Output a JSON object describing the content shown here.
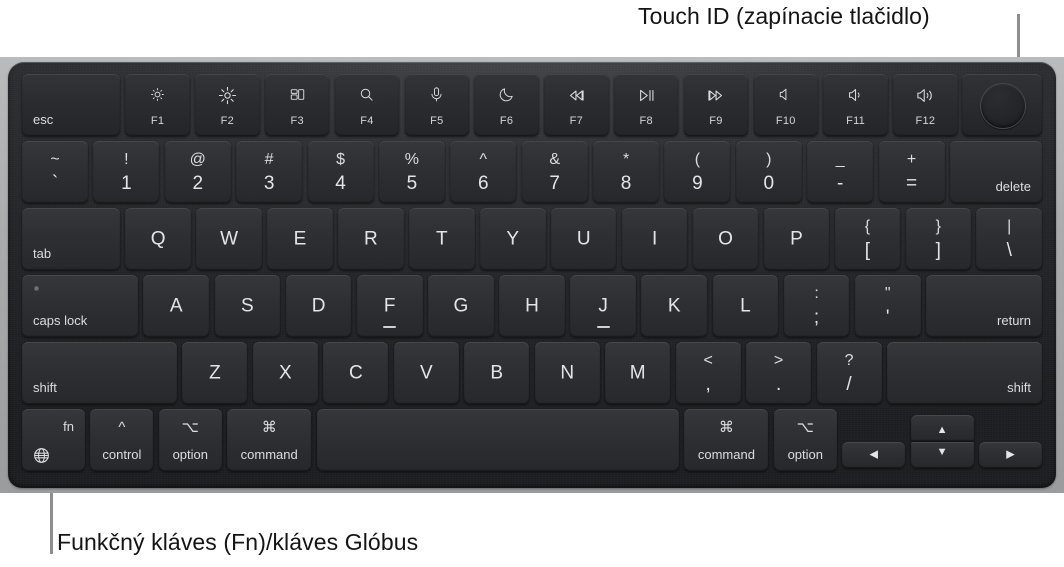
{
  "callouts": {
    "top": "Touch ID (zapínacie tlačidlo)",
    "bottom": "Funkčný kláves (Fn)/kláves Glóbus"
  },
  "colors": {
    "page_background": "#ffffff",
    "chassis_outer": "#aaacae",
    "deck_dark": "#26282b",
    "key_face": "#2d2f32",
    "key_text": "#e2e3e5",
    "leader_line": "#8e8e8e",
    "callout_text": "#141414"
  },
  "keyboard": {
    "layout_name": "MacBook US keyboard with Touch ID",
    "rows": {
      "function_row": [
        {
          "id": "esc",
          "main": "esc",
          "style": "word-bl"
        },
        {
          "id": "f1",
          "icon": "brightness-down-icon",
          "fnum": "F1",
          "style": "icon-fn"
        },
        {
          "id": "f2",
          "icon": "brightness-up-icon",
          "fnum": "F2",
          "style": "icon-fn"
        },
        {
          "id": "f3",
          "icon": "mission-control-icon",
          "fnum": "F3",
          "style": "icon-fn"
        },
        {
          "id": "f4",
          "icon": "spotlight-search-icon",
          "fnum": "F4",
          "style": "icon-fn"
        },
        {
          "id": "f5",
          "icon": "dictation-mic-icon",
          "fnum": "F5",
          "style": "icon-fn"
        },
        {
          "id": "f6",
          "icon": "do-not-disturb-moon-icon",
          "fnum": "F6",
          "style": "icon-fn"
        },
        {
          "id": "f7",
          "icon": "rewind-icon",
          "fnum": "F7",
          "style": "icon-fn"
        },
        {
          "id": "f8",
          "icon": "play-pause-icon",
          "fnum": "F8",
          "style": "icon-fn"
        },
        {
          "id": "f9",
          "icon": "fast-forward-icon",
          "fnum": "F9",
          "style": "icon-fn"
        },
        {
          "id": "f10",
          "icon": "volume-mute-icon",
          "fnum": "F10",
          "style": "icon-fn"
        },
        {
          "id": "f11",
          "icon": "volume-down-icon",
          "fnum": "F11",
          "style": "icon-fn"
        },
        {
          "id": "f12",
          "icon": "volume-up-icon",
          "fnum": "F12",
          "style": "icon-fn"
        },
        {
          "id": "touch-id",
          "icon": "touch-id-icon",
          "style": "touch-id"
        }
      ],
      "number_row": [
        {
          "id": "grave",
          "upper": "~",
          "lower": "`"
        },
        {
          "id": "1",
          "upper": "!",
          "lower": "1"
        },
        {
          "id": "2",
          "upper": "@",
          "lower": "2"
        },
        {
          "id": "3",
          "upper": "#",
          "lower": "3"
        },
        {
          "id": "4",
          "upper": "$",
          "lower": "4"
        },
        {
          "id": "5",
          "upper": "%",
          "lower": "5"
        },
        {
          "id": "6",
          "upper": "^",
          "lower": "6"
        },
        {
          "id": "7",
          "upper": "&",
          "lower": "7"
        },
        {
          "id": "8",
          "upper": "*",
          "lower": "8"
        },
        {
          "id": "9",
          "upper": "(",
          "lower": "9"
        },
        {
          "id": "0",
          "upper": ")",
          "lower": "0"
        },
        {
          "id": "minus",
          "upper": "_",
          "lower": "-"
        },
        {
          "id": "equal",
          "upper": "+",
          "lower": "="
        },
        {
          "id": "delete",
          "main": "delete",
          "style": "word-br"
        }
      ],
      "tab_row": [
        {
          "id": "tab",
          "main": "tab",
          "style": "word-bl"
        },
        {
          "id": "q",
          "main": "Q"
        },
        {
          "id": "w",
          "main": "W"
        },
        {
          "id": "e",
          "main": "E"
        },
        {
          "id": "r",
          "main": "R"
        },
        {
          "id": "t",
          "main": "T"
        },
        {
          "id": "y",
          "main": "Y"
        },
        {
          "id": "u",
          "main": "U"
        },
        {
          "id": "i",
          "main": "I"
        },
        {
          "id": "o",
          "main": "O"
        },
        {
          "id": "p",
          "main": "P"
        },
        {
          "id": "bracket-left",
          "upper": "{",
          "lower": "["
        },
        {
          "id": "bracket-right",
          "upper": "}",
          "lower": "]"
        },
        {
          "id": "backslash",
          "upper": "|",
          "lower": "\\"
        }
      ],
      "home_row": [
        {
          "id": "caps-lock",
          "main": "caps lock",
          "style": "word-bl",
          "indicator": true
        },
        {
          "id": "a",
          "main": "A"
        },
        {
          "id": "s",
          "main": "S"
        },
        {
          "id": "d",
          "main": "D"
        },
        {
          "id": "f",
          "main": "F",
          "homing": true
        },
        {
          "id": "g",
          "main": "G"
        },
        {
          "id": "h",
          "main": "H"
        },
        {
          "id": "j",
          "main": "J",
          "homing": true
        },
        {
          "id": "k",
          "main": "K"
        },
        {
          "id": "l",
          "main": "L"
        },
        {
          "id": "semicolon",
          "upper": ":",
          "lower": ";"
        },
        {
          "id": "quote",
          "upper": "\"",
          "lower": "'"
        },
        {
          "id": "return",
          "main": "return",
          "style": "word-br"
        }
      ],
      "shift_row": [
        {
          "id": "shift-left",
          "main": "shift",
          "style": "word-bl"
        },
        {
          "id": "z",
          "main": "Z"
        },
        {
          "id": "x",
          "main": "X"
        },
        {
          "id": "c",
          "main": "C"
        },
        {
          "id": "v",
          "main": "V"
        },
        {
          "id": "b",
          "main": "B"
        },
        {
          "id": "n",
          "main": "N"
        },
        {
          "id": "m",
          "main": "M"
        },
        {
          "id": "comma",
          "upper": "<",
          "lower": ","
        },
        {
          "id": "period",
          "upper": ">",
          "lower": "."
        },
        {
          "id": "slash",
          "upper": "?",
          "lower": "/"
        },
        {
          "id": "shift-right",
          "main": "shift",
          "style": "word-br"
        }
      ],
      "bottom_row": [
        {
          "id": "fn",
          "main": "fn",
          "icon": "globe-icon",
          "style": "fn-globe"
        },
        {
          "id": "control",
          "symbol": "^",
          "main": "control"
        },
        {
          "id": "option-left",
          "symbol": "⌥",
          "main": "option"
        },
        {
          "id": "command-left",
          "symbol": "⌘",
          "main": "command"
        },
        {
          "id": "space",
          "main": ""
        },
        {
          "id": "command-right",
          "symbol": "⌘",
          "main": "command"
        },
        {
          "id": "option-right",
          "symbol": "⌥",
          "main": "option"
        },
        {
          "id": "arrow-left",
          "main": "◀",
          "style": "arrow"
        },
        {
          "id": "arrow-up",
          "main": "▲",
          "style": "arrow"
        },
        {
          "id": "arrow-down",
          "main": "▼",
          "style": "arrow"
        },
        {
          "id": "arrow-right",
          "main": "▶",
          "style": "arrow"
        }
      ]
    }
  }
}
